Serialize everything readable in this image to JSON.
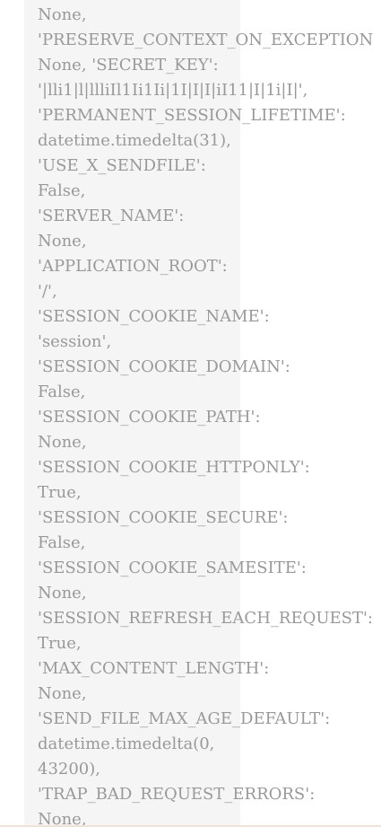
{
  "code_block": {
    "lines": [
      "None,",
      "'PRESERVE_CONTEXT_ON_EXCEPTION",
      "None, 'SECRET_KEY':",
      "'|lli1|l|llliIl1Ii1Ii|1I|I|I|iI11|I|1i|I|',",
      "'PERMANENT_SESSION_LIFETIME':",
      "datetime.timedelta(31),",
      "'USE_X_SENDFILE':",
      "False,",
      "'SERVER_NAME':",
      "None,",
      "'APPLICATION_ROOT':",
      "'/',",
      "'SESSION_COOKIE_NAME':",
      "'session',",
      "'SESSION_COOKIE_DOMAIN':",
      "False,",
      "'SESSION_COOKIE_PATH':",
      "None,",
      "'SESSION_COOKIE_HTTPONLY':",
      "True,",
      "'SESSION_COOKIE_SECURE':",
      "False,",
      "'SESSION_COOKIE_SAMESITE':",
      "None,",
      "'SESSION_REFRESH_EACH_REQUEST':",
      "True,",
      "'MAX_CONTENT_LENGTH':",
      "None,",
      "'SEND_FILE_MAX_AGE_DEFAULT':",
      "datetime.timedelta(0,",
      "43200),",
      "'TRAP_BAD_REQUEST_ERRORS':",
      "None,"
    ]
  },
  "colors": {
    "text": "#999999",
    "panel_background": "#f5f5f5",
    "page_background": "#ffffff"
  }
}
